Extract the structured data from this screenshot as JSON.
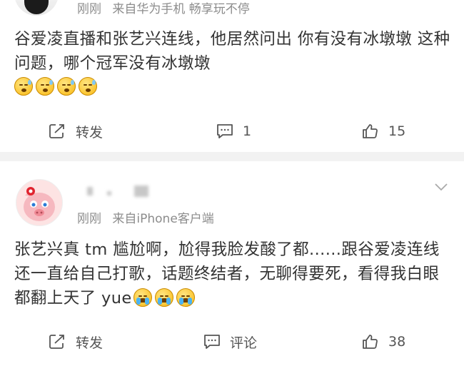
{
  "posts": [
    {
      "meta": {
        "time": "刚刚",
        "source": "来自华为手机 畅享玩不停"
      },
      "body": "谷爱凌直播和张艺兴连线，他居然问出 你有没有冰墩墩 这种问题，哪个冠军没有冰墩墩",
      "emoji": [
        "sweat-emoji",
        "sweat-emoji",
        "sweat-emoji",
        "sweat-emoji"
      ],
      "actions": {
        "repost": "转发",
        "comment": "1",
        "like": "15"
      }
    },
    {
      "meta": {
        "time": "刚刚",
        "source": "来自iPhone客户端"
      },
      "body": "张艺兴真 tm 尴尬啊，尬得我脸发酸了都......跟谷爱凌连线还一直给自己打歌，话题终结者，无聊得要死，看得我白眼都翻上天了 yue",
      "emoji": [
        "crying-emoji",
        "crying-emoji",
        "crying-emoji"
      ],
      "actions": {
        "repost": "转发",
        "comment": "评论",
        "like": "38"
      }
    }
  ],
  "colors": {
    "text": "#333333",
    "meta": "#8c8c8c",
    "background": "#f2f2f2",
    "card": "#ffffff"
  }
}
